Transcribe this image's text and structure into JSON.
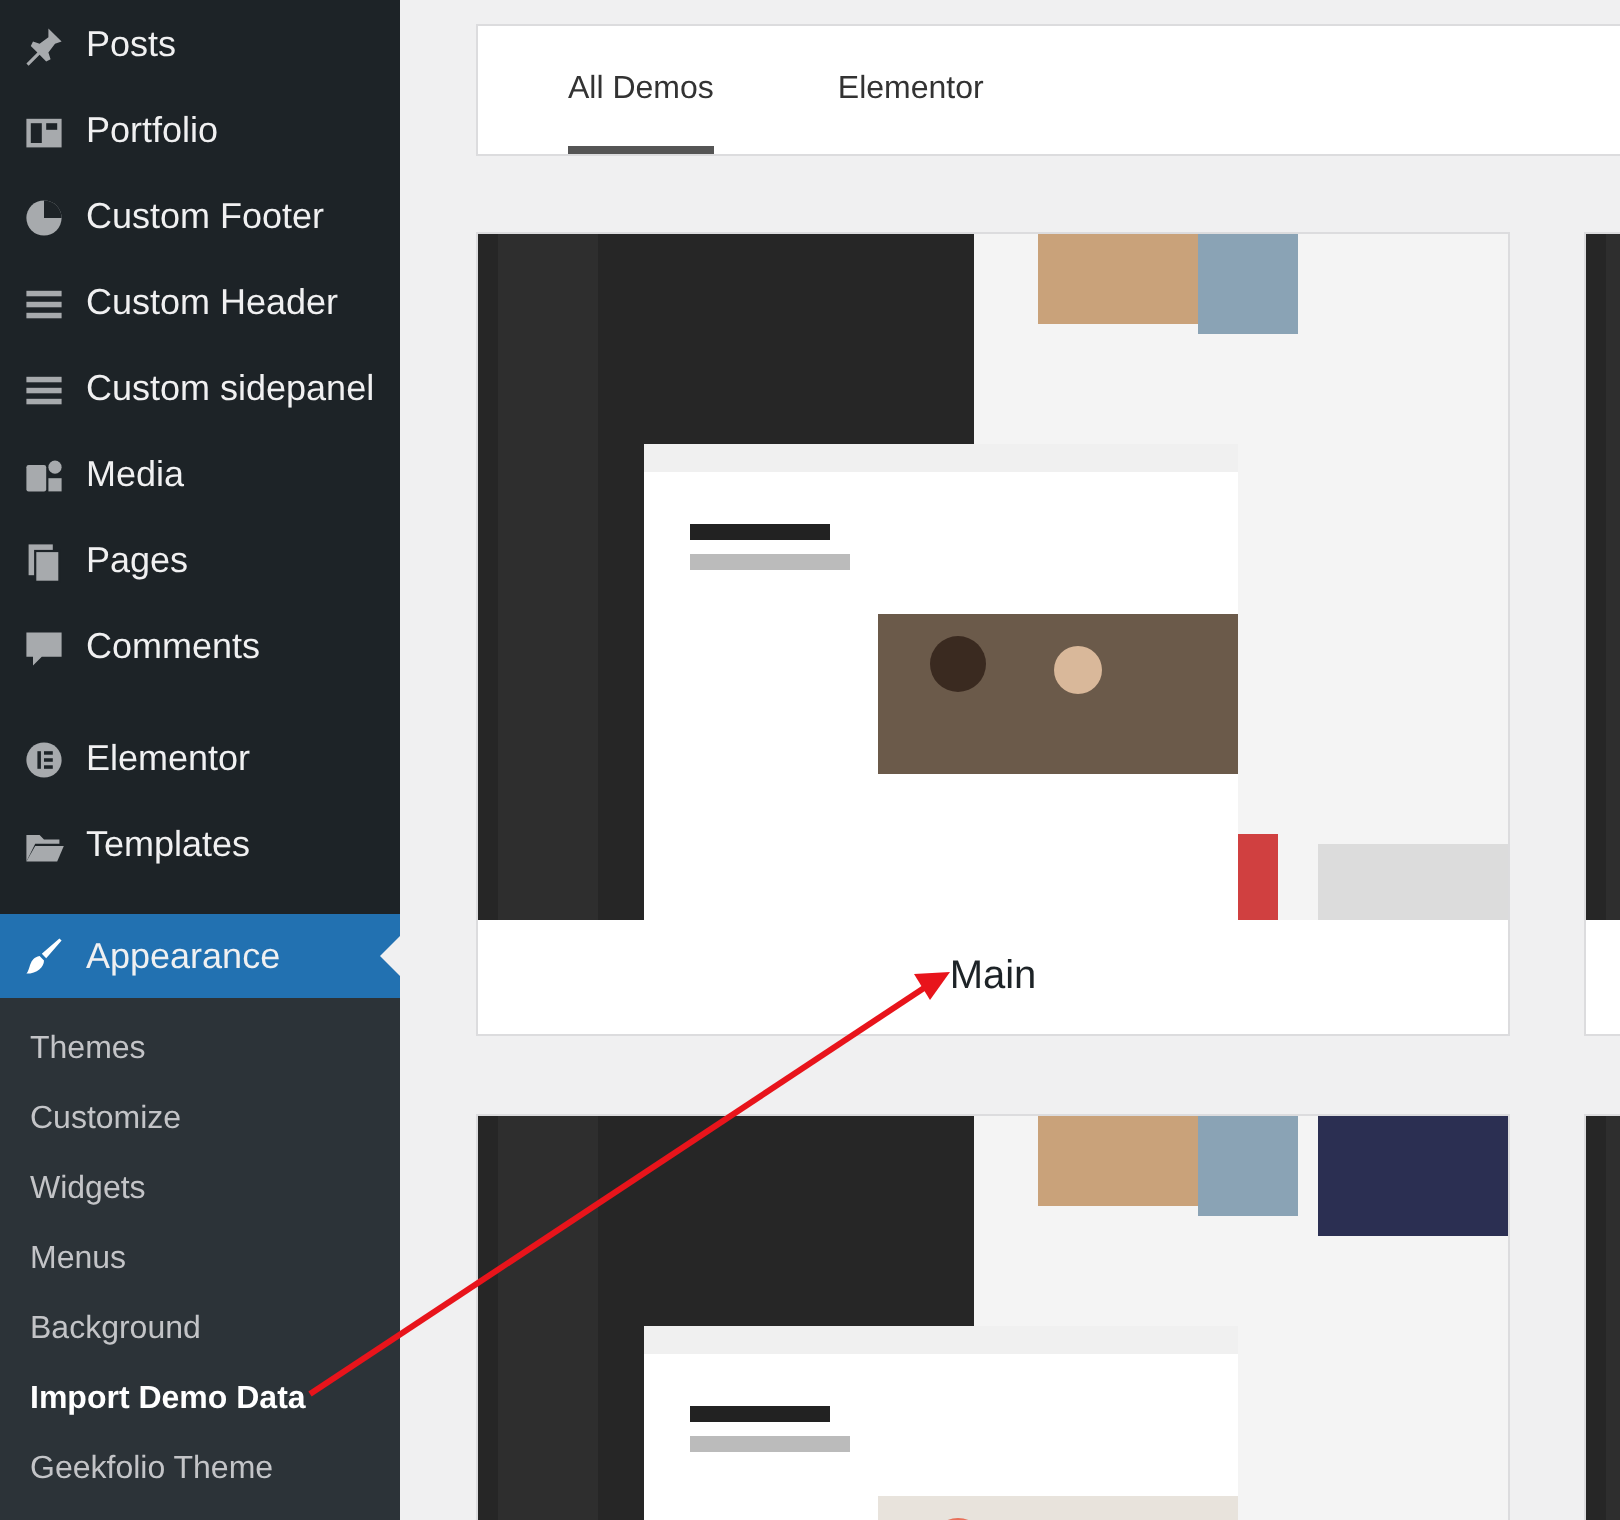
{
  "sidebar": {
    "menu_groups": [
      [
        {
          "label": "Posts",
          "selected": false
        },
        {
          "label": "Portfolio",
          "selected": false
        },
        {
          "label": "Custom Footer",
          "selected": false
        },
        {
          "label": "Custom Header",
          "selected": false
        },
        {
          "label": "Custom sidepanel",
          "selected": false
        },
        {
          "label": "Media",
          "selected": false
        },
        {
          "label": "Pages",
          "selected": false
        },
        {
          "label": "Comments",
          "selected": false
        }
      ],
      [
        {
          "label": "Elementor",
          "selected": false
        },
        {
          "label": "Templates",
          "selected": false
        }
      ],
      [
        {
          "label": "Appearance",
          "selected": true
        }
      ]
    ],
    "submenu": [
      {
        "label": "Themes",
        "selected": false
      },
      {
        "label": "Customize",
        "selected": false
      },
      {
        "label": "Widgets",
        "selected": false
      },
      {
        "label": "Menus",
        "selected": false
      },
      {
        "label": "Background",
        "selected": false
      },
      {
        "label": "Import Demo Data",
        "selected": true
      },
      {
        "label": "Geekfolio Theme",
        "selected": false
      }
    ]
  },
  "tabs": [
    {
      "label": "All Demos",
      "selected": true
    },
    {
      "label": "Elementor",
      "selected": false
    }
  ],
  "demos": [
    {
      "kind": "picture",
      "title": "Main"
    },
    {
      "kind": "picture"
    },
    {
      "kind": "picture"
    },
    {
      "kind": "picture"
    }
  ]
}
